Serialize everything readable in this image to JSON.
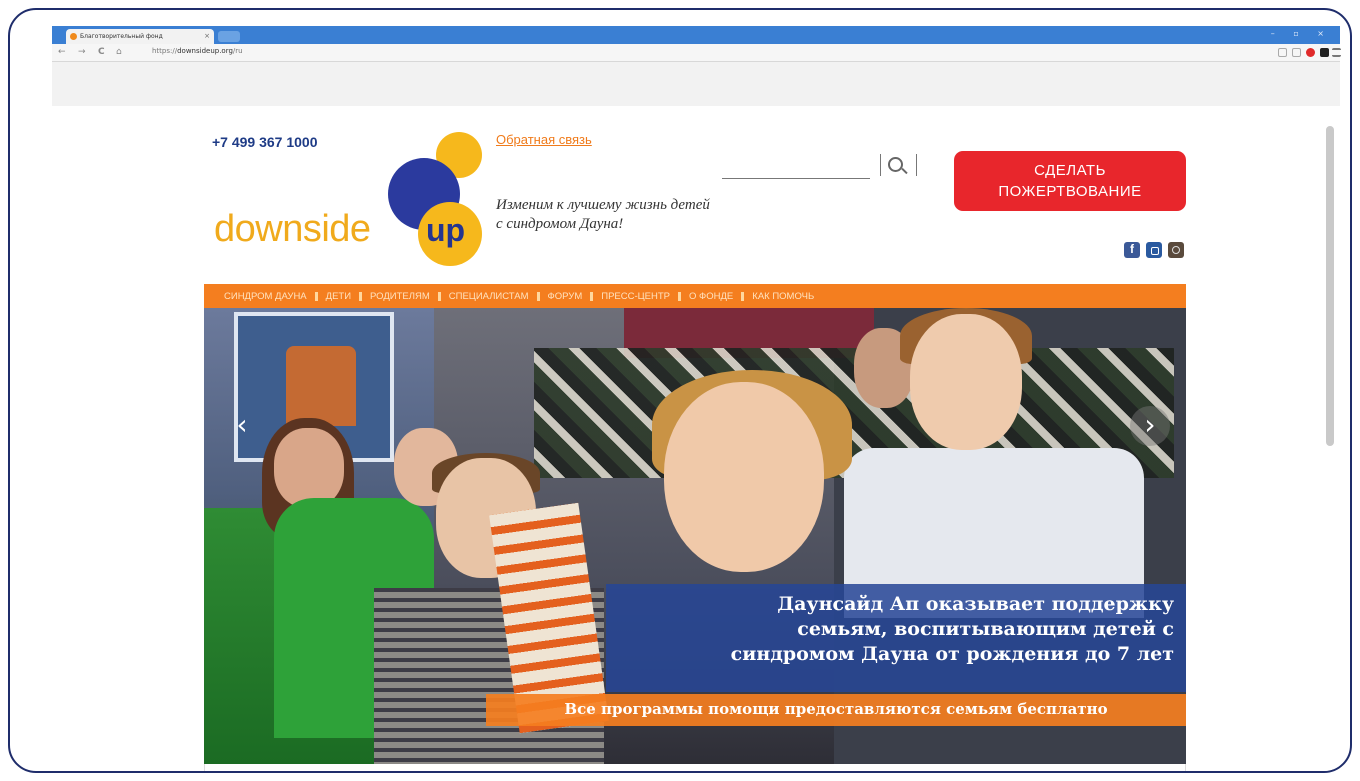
{
  "browser": {
    "tab_title": "Благотворительный фонд",
    "tab_close": "×",
    "url_prefix": "https://",
    "url_host": "downsideup.org",
    "url_path": "/ru",
    "window_controls": "– ▫ ×",
    "nav_back": "←",
    "nav_forward": "→",
    "nav_reload": "C",
    "nav_home": "⌂"
  },
  "site": {
    "phone": "+7 499 367 1000",
    "logo_word": "downside",
    "logo_up": "up",
    "feedback": "Обратная связь",
    "tagline_line1": "Изменим к лучшему жизнь детей",
    "tagline_line2": "с синдромом Дауна!",
    "donate_line1": "СДЕЛАТЬ",
    "donate_line2": "ПОЖЕРТВОВАНИЕ",
    "social_fb": "f",
    "menu": [
      "СИНДРОМ ДАУНА",
      "ДЕТИ",
      "РОДИТЕЛЯМ",
      "СПЕЦИАЛИСТАМ",
      "ФОРУМ",
      "ПРЕСС-ЦЕНТР",
      "О ФОНДЕ",
      "КАК ПОМОЧЬ"
    ],
    "hero": {
      "arrow_left": "‹",
      "arrow_right": "›",
      "caption_line1": "Даунсайд Ап оказывает поддержку",
      "caption_line2": "семьям, воспитывающим детей с",
      "caption_line3": "синдромом Дауна от рождения до 7 лет",
      "subcaption": "Все программы помощи предоставляются семьям бесплатно"
    }
  },
  "colors": {
    "frame_border": "#1f2d6b",
    "tabbar": "#3a7fd3",
    "brand_orange": "#f47e1f",
    "brand_yellow": "#f6b81c",
    "brand_navy": "#2b3a9e",
    "donate_red": "#e8262c",
    "caption_blue": "#274696"
  }
}
